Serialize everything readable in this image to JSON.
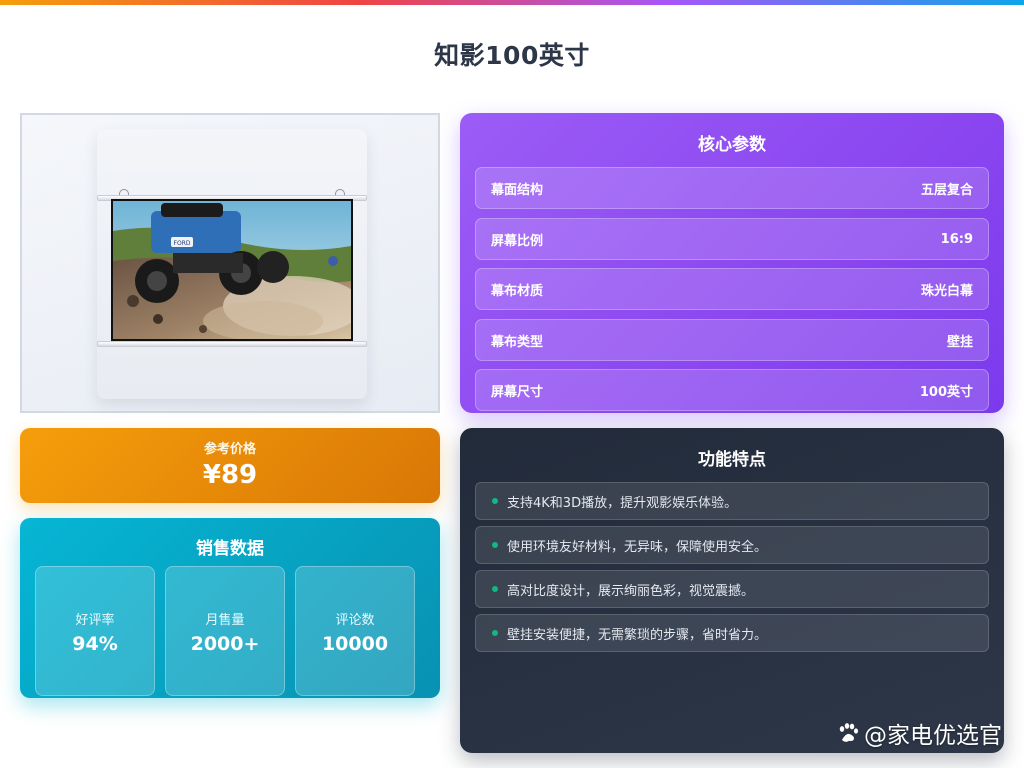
{
  "page": {
    "title": "知影100英寸"
  },
  "image_panel": {
    "screen_badge_text": "FORD"
  },
  "core_params": {
    "title": "核心参数",
    "rows": [
      {
        "label": "幕面结构",
        "value": "五层复合"
      },
      {
        "label": "屏幕比例",
        "value": "16:9"
      },
      {
        "label": "幕布材质",
        "value": "珠光白幕"
      },
      {
        "label": "幕布类型",
        "value": "壁挂"
      },
      {
        "label": "屏幕尺寸",
        "value": "100英寸"
      }
    ]
  },
  "price": {
    "label": "参考价格",
    "value": "¥89"
  },
  "sales": {
    "title": "销售数据",
    "stats": [
      {
        "label": "好评率",
        "value": "94%"
      },
      {
        "label": "月售量",
        "value": "2000+"
      },
      {
        "label": "评论数",
        "value": "10000"
      }
    ]
  },
  "features": {
    "title": "功能特点",
    "items": [
      "支持4K和3D播放，提升观影娱乐体验。",
      "使用环境友好材料，无异味，保障使用安全。",
      "高对比度设计，展示绚丽色彩，视觉震撼。",
      "壁挂安装便捷，无需繁琐的步骤，省时省力。"
    ]
  },
  "watermark": {
    "text": "@家电优选官",
    "icon": "paw-icon"
  },
  "colors": {
    "params_bg": "#8b46f0",
    "price_bg": "#f59e0b",
    "sales_bg": "#06b6d4",
    "features_bg": "#2d3748",
    "bullet": "#10b981"
  }
}
